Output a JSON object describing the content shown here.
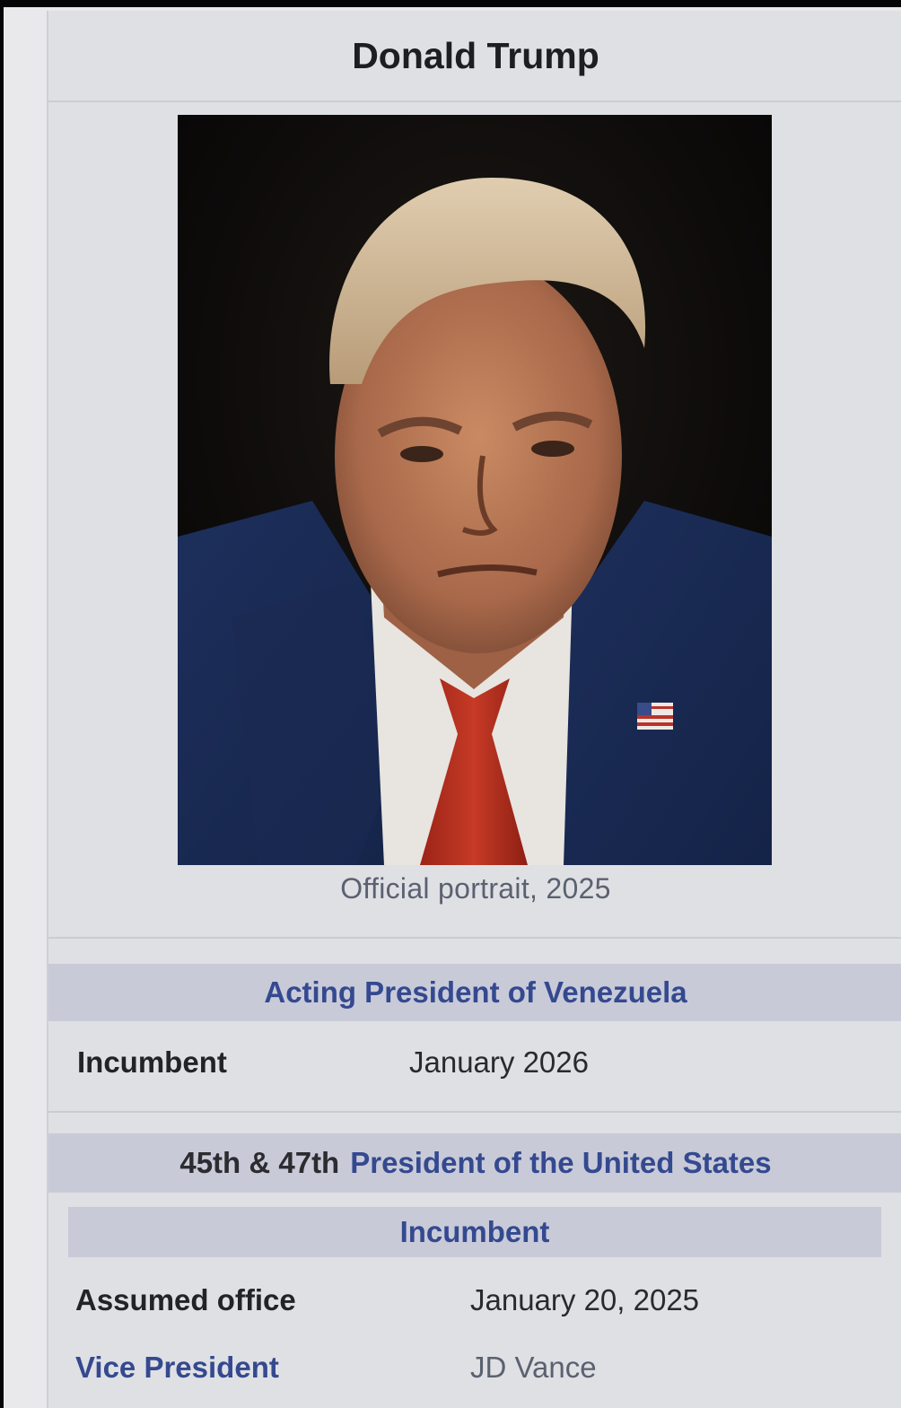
{
  "infobox": {
    "title": "Donald Trump",
    "portrait": {
      "caption": "Official portrait, 2025"
    },
    "sections": [
      {
        "header": "Acting President of Venezuela",
        "rows": [
          {
            "label": "Incumbent",
            "value": "January 2026"
          }
        ]
      },
      {
        "header_prefix": "45th & 47th",
        "header": "President of the United States",
        "subheader": "Incumbent",
        "rows": [
          {
            "label": "Assumed office",
            "value": "January 20, 2025"
          },
          {
            "label": "Vice President",
            "value": "JD Vance"
          }
        ]
      }
    ]
  },
  "colors": {
    "link": "#34498f",
    "header_band": "#c8cad8",
    "background": "#dfe0e4"
  }
}
